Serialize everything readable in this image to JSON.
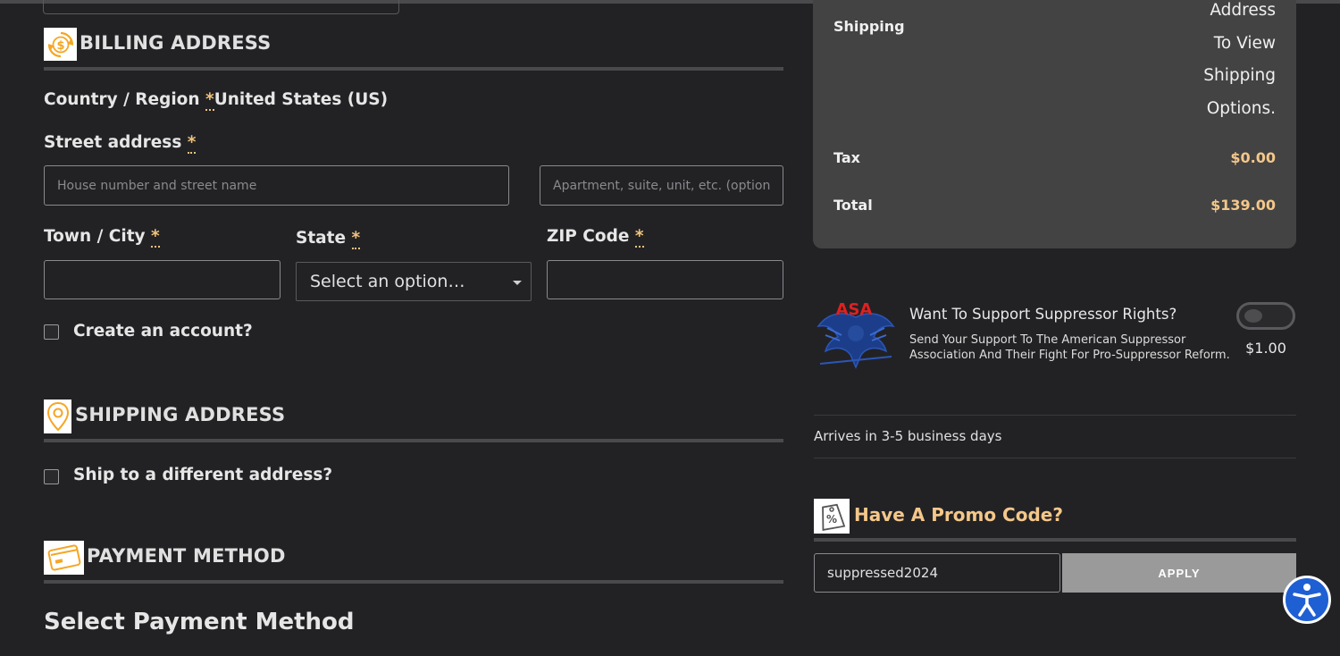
{
  "billing": {
    "title": "BILLING ADDRESS",
    "country_label": "Country / Region",
    "required_mark": "*",
    "country_value": "United States (US)",
    "street_label": "Street address",
    "street_placeholder": "House number and street name",
    "apt_placeholder": "Apartment, suite, unit, etc. (optional)",
    "city_label": "Town / City",
    "state_label": "State",
    "state_selected": "Select an option…",
    "zip_label": "ZIP Code",
    "create_account_label": "Create an account?"
  },
  "shipping": {
    "title": "SHIPPING ADDRESS",
    "different_address_label": "Ship to a different address?"
  },
  "payment": {
    "title": "PAYMENT METHOD",
    "subtitle": "Select Payment Method"
  },
  "summary": {
    "shipping_label": "Shipping",
    "shipping_message": [
      "Address",
      "To View",
      "Shipping",
      "Options."
    ],
    "tax_label": "Tax",
    "tax_value": "$0.00",
    "total_label": "Total",
    "total_value": "$139.00"
  },
  "donation": {
    "logo_text": "ASA",
    "title": "Want To Support Suppressor Rights?",
    "description_line1": "Send Your Support To The American Suppressor",
    "description_line2": "Association And Their Fight For Pro-Suppressor Reform.",
    "amount": "$1.00",
    "enabled": false
  },
  "delivery": {
    "text": "Arrives in 3-5 business days"
  },
  "promo": {
    "title": "Have A Promo Code?",
    "code_value": "suppressed2024",
    "apply_label": "APPLY"
  },
  "colors": {
    "background": "#222225",
    "accent_gold": "#f4c78a",
    "icon_orange": "#f5a623",
    "summary_panel": "#434343",
    "accessibility_blue": "#1f5fd4"
  }
}
